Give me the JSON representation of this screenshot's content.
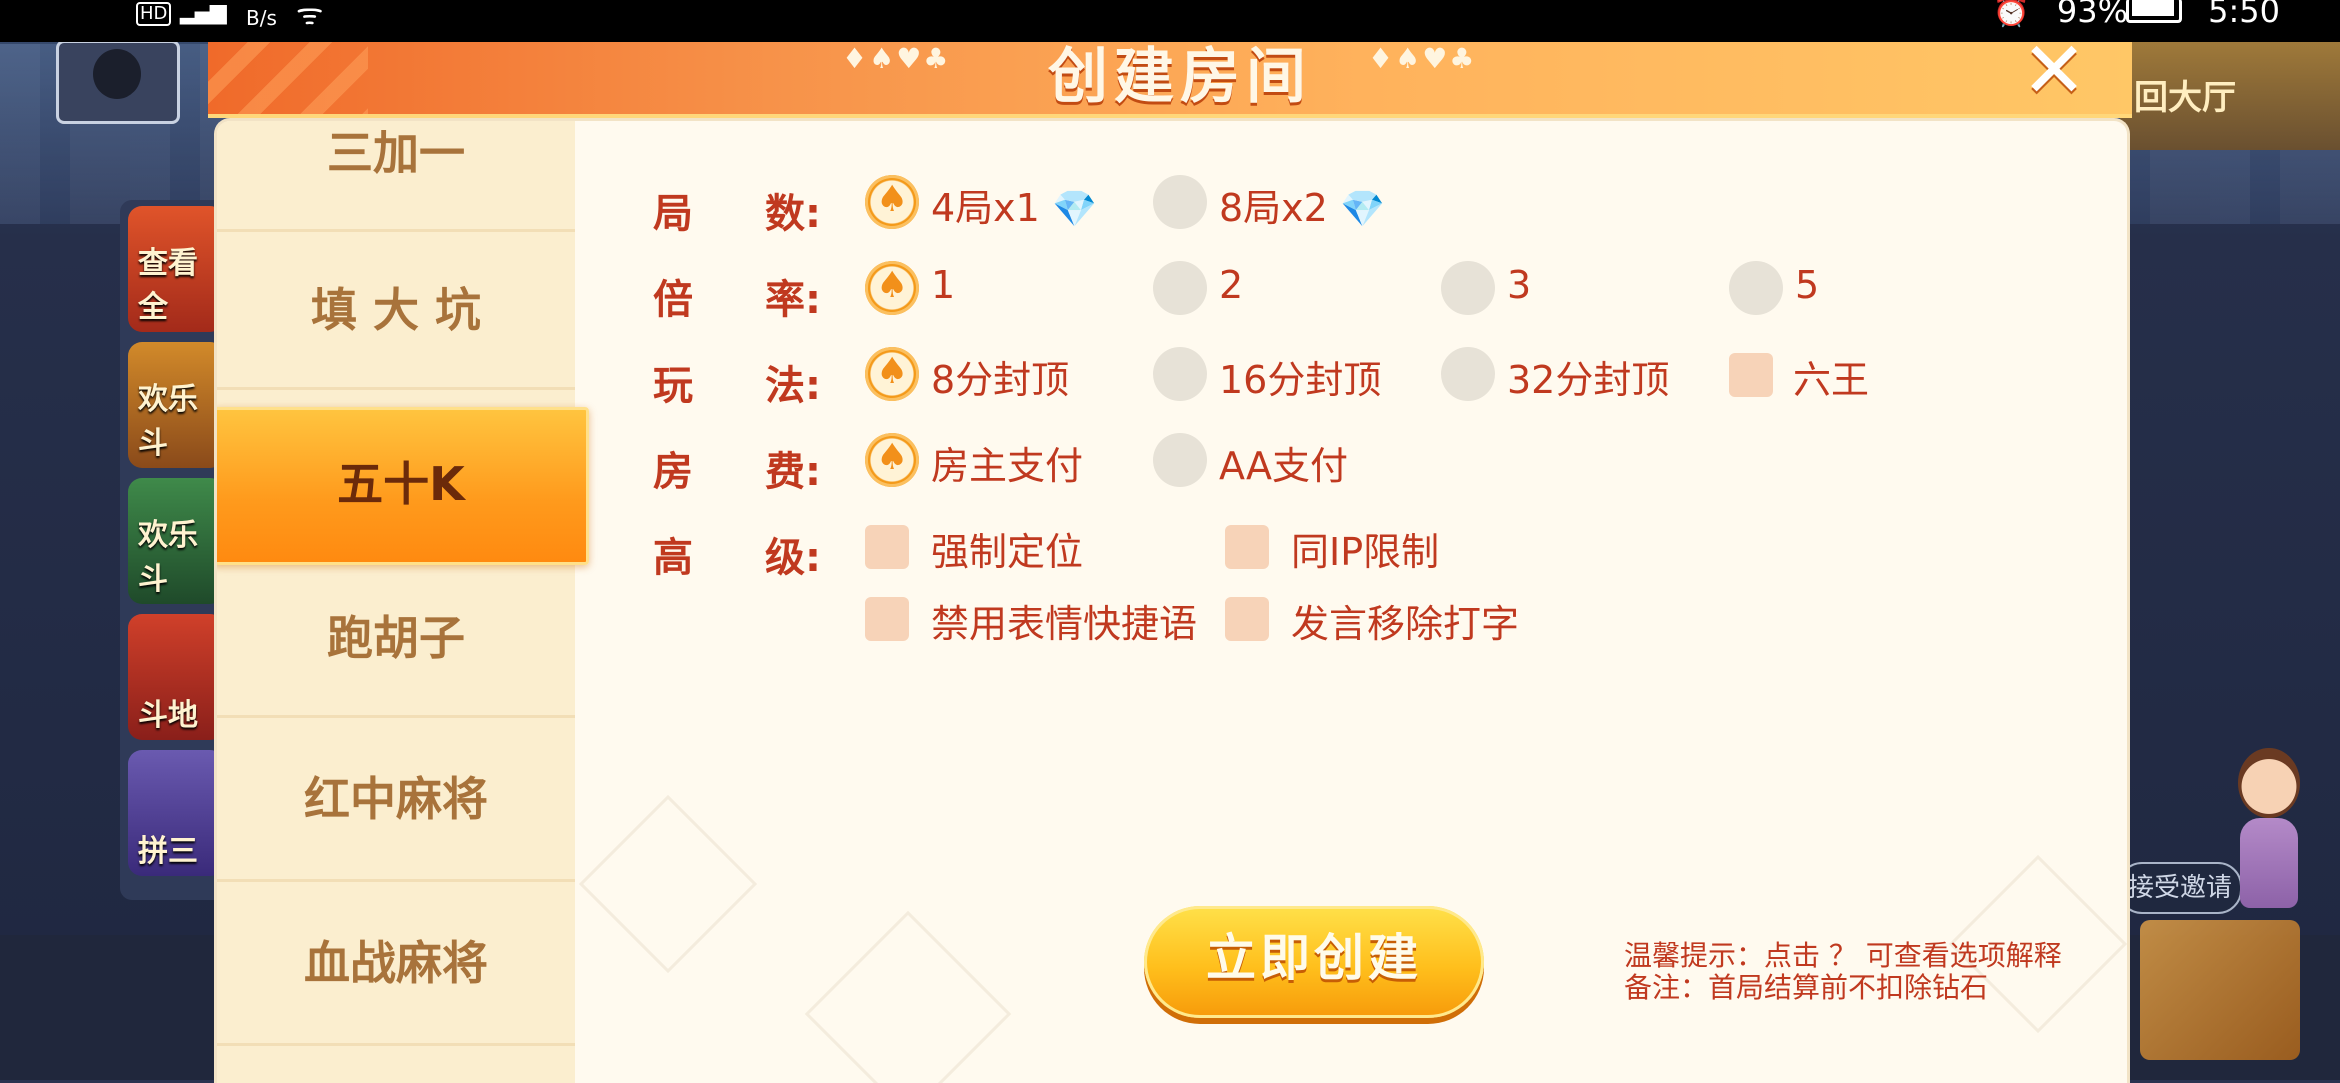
{
  "status_bar": {
    "hd": "HD",
    "speed_unit": "B/s",
    "battery": "93%",
    "time": "5:50"
  },
  "background": {
    "return_hall": "回大厅",
    "accept_invite": "接受邀请",
    "left_games": [
      "查看全",
      "欢乐斗",
      "欢乐斗",
      "斗地",
      "拼三"
    ]
  },
  "dialog": {
    "title": "创建房间",
    "close_icon": "close-icon",
    "sidebar": [
      {
        "label": "三加一",
        "active": false
      },
      {
        "label": "填 大 坑",
        "active": false
      },
      {
        "label": "五十K",
        "active": true
      },
      {
        "label": "跑胡子",
        "active": false
      },
      {
        "label": "红中麻将",
        "active": false
      },
      {
        "label": "血战麻将",
        "active": false
      }
    ],
    "rows": {
      "rounds": {
        "label1": "局",
        "label2": "数:",
        "options": [
          "4局x1",
          "8局x2"
        ],
        "selected": 0,
        "icon": "diamond-icon"
      },
      "rate": {
        "label1": "倍",
        "label2": "率:",
        "options": [
          "1",
          "2",
          "3",
          "5"
        ],
        "selected": 0
      },
      "play": {
        "label1": "玩",
        "label2": "法:",
        "options": [
          "8分封顶",
          "16分封顶",
          "32分封顶"
        ],
        "selected": 0,
        "checkbox": "六王"
      },
      "fee": {
        "label1": "房",
        "label2": "费:",
        "options": [
          "房主支付",
          "AA支付"
        ],
        "selected": 0
      },
      "advanced": {
        "label1": "高",
        "label2": "级:",
        "checkboxes": [
          "强制定位",
          "同IP限制",
          "禁用表情快捷语",
          "发言移除打字"
        ]
      }
    },
    "create_button": "立即创建",
    "tips": {
      "line1": "温馨提示：点击 ？ 可查看选项解释",
      "line2": "备注：首局结算前不扣除钻石"
    }
  },
  "colors": {
    "accent_red": "#c0391f",
    "header_orange": "#f7934a",
    "button_yellow": "#ffbf1c"
  }
}
